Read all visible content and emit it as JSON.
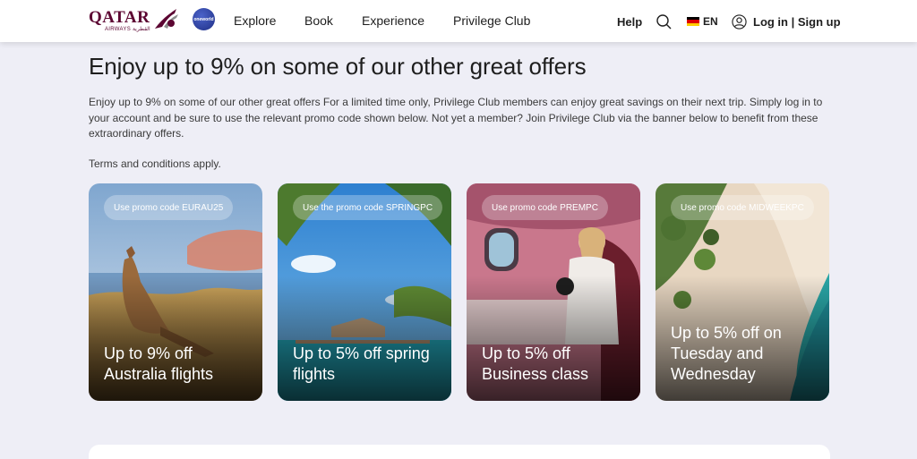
{
  "header": {
    "logo_text": "QATAR",
    "logo_sub": "AIRWAYS القطرية",
    "alliance_badge": "oneworld",
    "nav": [
      {
        "label": "Explore"
      },
      {
        "label": "Book"
      },
      {
        "label": "Experience"
      },
      {
        "label": "Privilege Club"
      }
    ],
    "help_label": "Help",
    "search_icon": "search-icon",
    "language": "EN",
    "flag_colors": [
      "#000000",
      "#dd0000",
      "#ffce00"
    ],
    "login_label": "Log in | Sign up"
  },
  "main": {
    "title": "Enjoy up to 9% on some of our other great offers",
    "intro": "Enjoy up to 9% on some of our other great offers For a limited time only, Privilege Club members can enjoy great savings on their next trip. Simply log in to your account and be sure to use the relevant promo code shown below. Not yet a member? Join Privilege Club via the banner below to benefit from these extraordinary offers.",
    "terms": "Terms and conditions apply."
  },
  "offers": [
    {
      "promo": "Use promo code EURAU25",
      "title": "Up to 9% off Australia flights"
    },
    {
      "promo": "Use the promo code SPRINGPC",
      "title": "Up to 5% off spring flights"
    },
    {
      "promo": "Use promo code PREMPC",
      "title": "Up to 5% off Business class"
    },
    {
      "promo": "Use promo code MIDWEEKPC",
      "title": "Up to 5% off on Tuesday and Wednesday"
    }
  ],
  "colors": {
    "brand": "#5c0632",
    "background": "#eeeef6"
  }
}
